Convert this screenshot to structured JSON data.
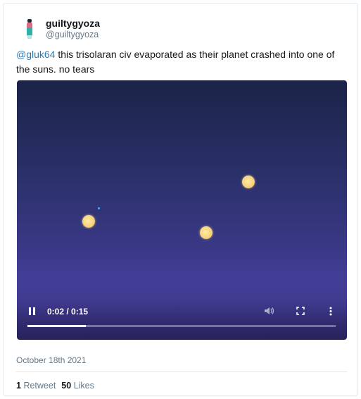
{
  "tweet": {
    "display_name": "guiltygyoza",
    "handle": "@guiltygyoza",
    "mention": "@gluk64",
    "text": " this trisolaran civ evaporated as their planet crashed into one of the suns. no tears",
    "date": "October 18th 2021",
    "retweet_count": "1",
    "retweet_label": "Retweet",
    "like_count": "50",
    "like_label": "Likes"
  },
  "video": {
    "time": "0:02 / 0:15",
    "progress_fraction": 0.19,
    "sun_color": "#f6d27a",
    "planet_color": "#39b4ff",
    "icons": [
      "pause-icon",
      "volume-icon",
      "fullscreen-icon",
      "more-options-icon"
    ]
  }
}
